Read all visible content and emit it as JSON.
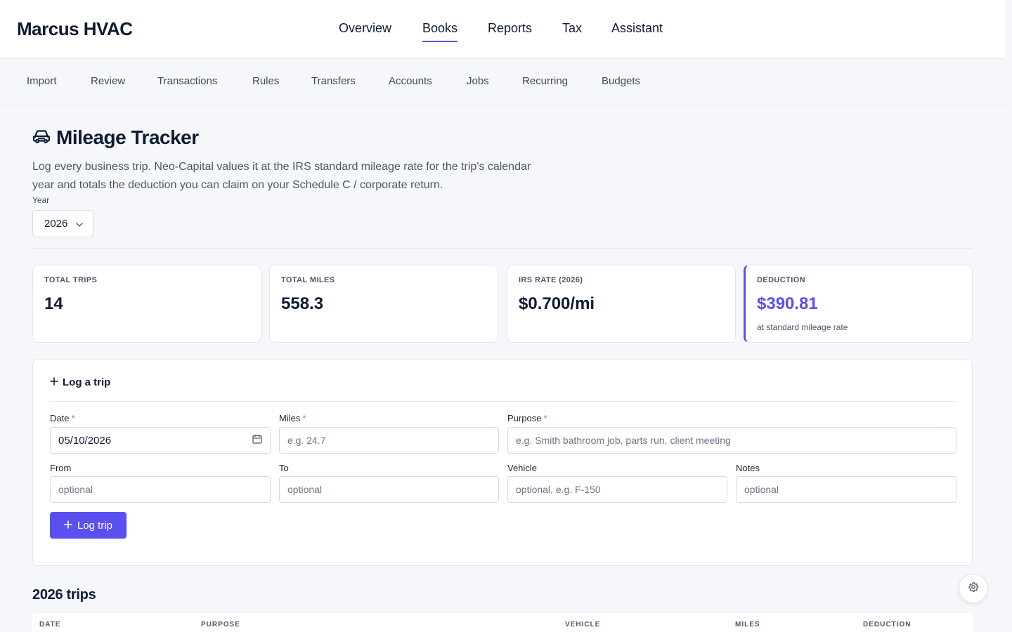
{
  "app": {
    "brand": "Marcus HVAC"
  },
  "main_nav": [
    {
      "label": "Overview",
      "active": false
    },
    {
      "label": "Books",
      "active": true
    },
    {
      "label": "Reports",
      "active": false
    },
    {
      "label": "Tax",
      "active": false
    },
    {
      "label": "Assistant",
      "active": false
    }
  ],
  "sub_nav": [
    "Import",
    "Review",
    "Transactions",
    "Rules",
    "Transfers",
    "Accounts",
    "Jobs",
    "Recurring",
    "Budgets"
  ],
  "page": {
    "title": "Mileage Tracker",
    "title_icon": "car-icon",
    "description": "Log every business trip. Neo-Capital values it at the IRS standard mileage rate for the trip's calendar year and totals the deduction you can claim on your Schedule C / corporate return.",
    "year_label": "Year",
    "year_value": "2026"
  },
  "stats": [
    {
      "label": "TOTAL TRIPS",
      "value": "14",
      "note": ""
    },
    {
      "label": "TOTAL MILES",
      "value": "558.3",
      "note": ""
    },
    {
      "label": "IRS RATE (2026)",
      "value": "$0.700/mi",
      "note": ""
    },
    {
      "label": "DEDUCTION",
      "value": "$390.81",
      "note": "at standard mileage rate"
    }
  ],
  "form": {
    "heading": "Log a trip",
    "date": {
      "label": "Date",
      "value": "05/10/2026",
      "required": true
    },
    "miles": {
      "label": "Miles",
      "placeholder": "e.g. 24.7",
      "required": true
    },
    "purpose": {
      "label": "Purpose",
      "placeholder": "e.g. Smith bathroom job, parts run, client meeting",
      "required": true
    },
    "from": {
      "label": "From",
      "placeholder": "optional"
    },
    "to": {
      "label": "To",
      "placeholder": "optional"
    },
    "vehicle": {
      "label": "Vehicle",
      "placeholder": "optional, e.g. F-150"
    },
    "notes": {
      "label": "Notes",
      "placeholder": "optional"
    },
    "submit_label": "Log trip",
    "required_marker": "*"
  },
  "trips": {
    "title": "2026 trips",
    "columns": [
      "DATE",
      "PURPOSE",
      "VEHICLE",
      "MILES",
      "DEDUCTION"
    ]
  },
  "colors": {
    "accent": "#5b4ff0",
    "required": "#e06a3c",
    "text": "#0f1b33"
  }
}
